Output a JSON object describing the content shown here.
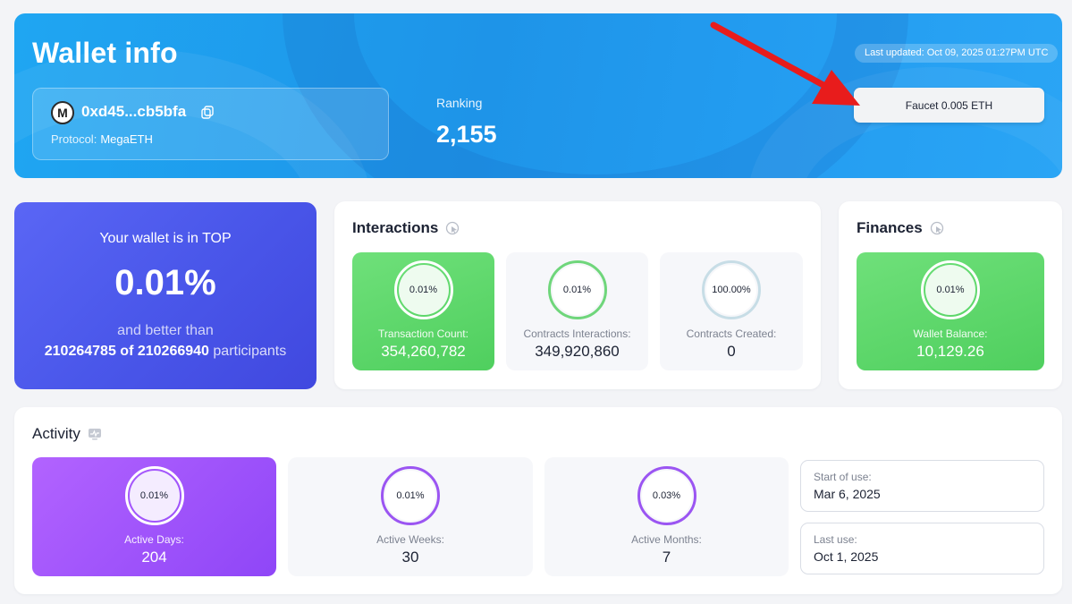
{
  "hero": {
    "title": "Wallet info",
    "address": "0xd45...cb5bfa",
    "logo_letter": "M",
    "protocol_label": "Protocol:",
    "protocol_value": "MegaETH",
    "ranking_label": "Ranking",
    "ranking_value": "2,155",
    "last_updated": "Last updated: Oct 09, 2025 01:27PM UTC",
    "faucet_button": "Faucet 0.005 ETH"
  },
  "top": {
    "line1": "Your wallet is in TOP",
    "percent": "0.01%",
    "line3": "and better than",
    "count_a": "210264785",
    "of": "of",
    "count_b": "210266940",
    "participants": "participants"
  },
  "interactions": {
    "title": "Interactions",
    "tiles": [
      {
        "ring": "0.01%",
        "label": "Transaction Count:",
        "value": "354,260,782",
        "style": "green"
      },
      {
        "ring": "0.01%",
        "label": "Contracts Interactions:",
        "value": "349,920,860",
        "style": "gray"
      },
      {
        "ring": "100.00%",
        "label": "Contracts Created:",
        "value": "0",
        "style": "gray"
      }
    ]
  },
  "finances": {
    "title": "Finances",
    "tiles": [
      {
        "ring": "0.01%",
        "label": "Wallet Balance:",
        "value": "10,129.26",
        "style": "green"
      }
    ]
  },
  "activity": {
    "title": "Activity",
    "tiles": [
      {
        "ring": "0.01%",
        "label": "Active Days:",
        "value": "204",
        "style": "purple"
      },
      {
        "ring": "0.01%",
        "label": "Active Weeks:",
        "value": "30",
        "style": "gray"
      },
      {
        "ring": "0.03%",
        "label": "Active Months:",
        "value": "7",
        "style": "gray"
      }
    ],
    "start_label": "Start of use:",
    "start_value": "Mar 6, 2025",
    "last_label": "Last use:",
    "last_value": "Oct 1, 2025"
  },
  "colors": {
    "hero_blue": "#1f9cef",
    "top_card": "#4a57ea",
    "green_tile": "#5bd86a",
    "purple_tile": "#9d52fb",
    "arrow_red": "#e81c1c"
  }
}
